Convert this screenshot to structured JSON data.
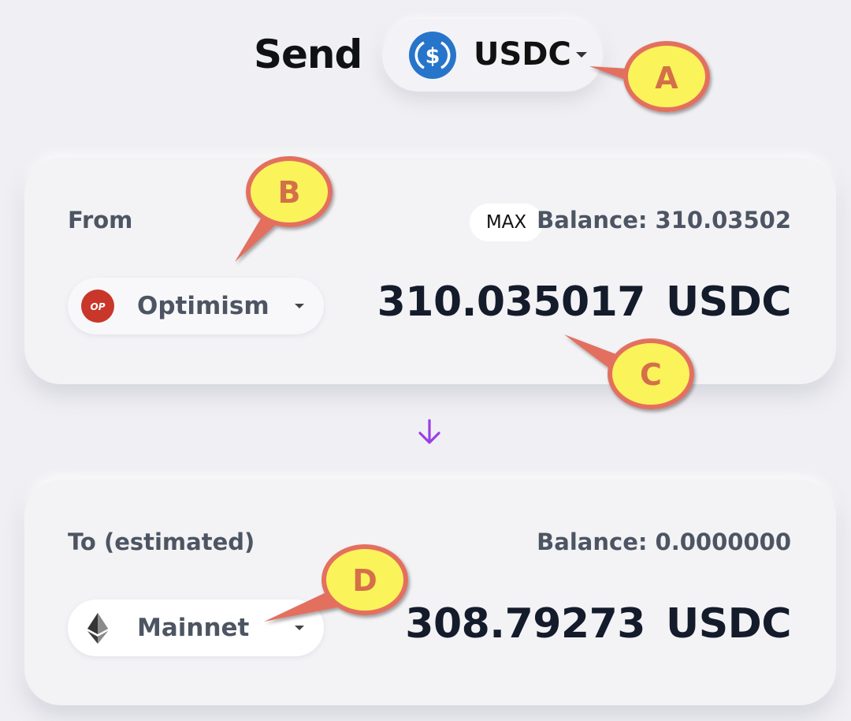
{
  "header": {
    "title": "Send"
  },
  "token": {
    "symbol": "USDC",
    "icon": "usdc-dollar-icon",
    "color": "#2775ca"
  },
  "from": {
    "label": "From",
    "max_label": "MAX",
    "balance_text": "Balance: 310.03502",
    "chain": {
      "name": "Optimism",
      "icon": "optimism-op-icon",
      "icon_text": "OP",
      "color": "#c8372a"
    },
    "amount": "310.035017",
    "unit": "USDC"
  },
  "to": {
    "label": "To (estimated)",
    "balance_text": "Balance: 0.0000000",
    "chain": {
      "name": "Mainnet",
      "icon": "ethereum-icon"
    },
    "amount": "308.79273",
    "unit": "USDC"
  },
  "arrow": {
    "icon": "arrow-down-icon",
    "color": "#9b3ee6"
  },
  "annotations": [
    {
      "letter": "A"
    },
    {
      "letter": "B"
    },
    {
      "letter": "C"
    },
    {
      "letter": "D"
    }
  ],
  "annotation_style": {
    "fill": "#fbf35a",
    "stroke": "#e3705f",
    "text": "#d4704a"
  }
}
